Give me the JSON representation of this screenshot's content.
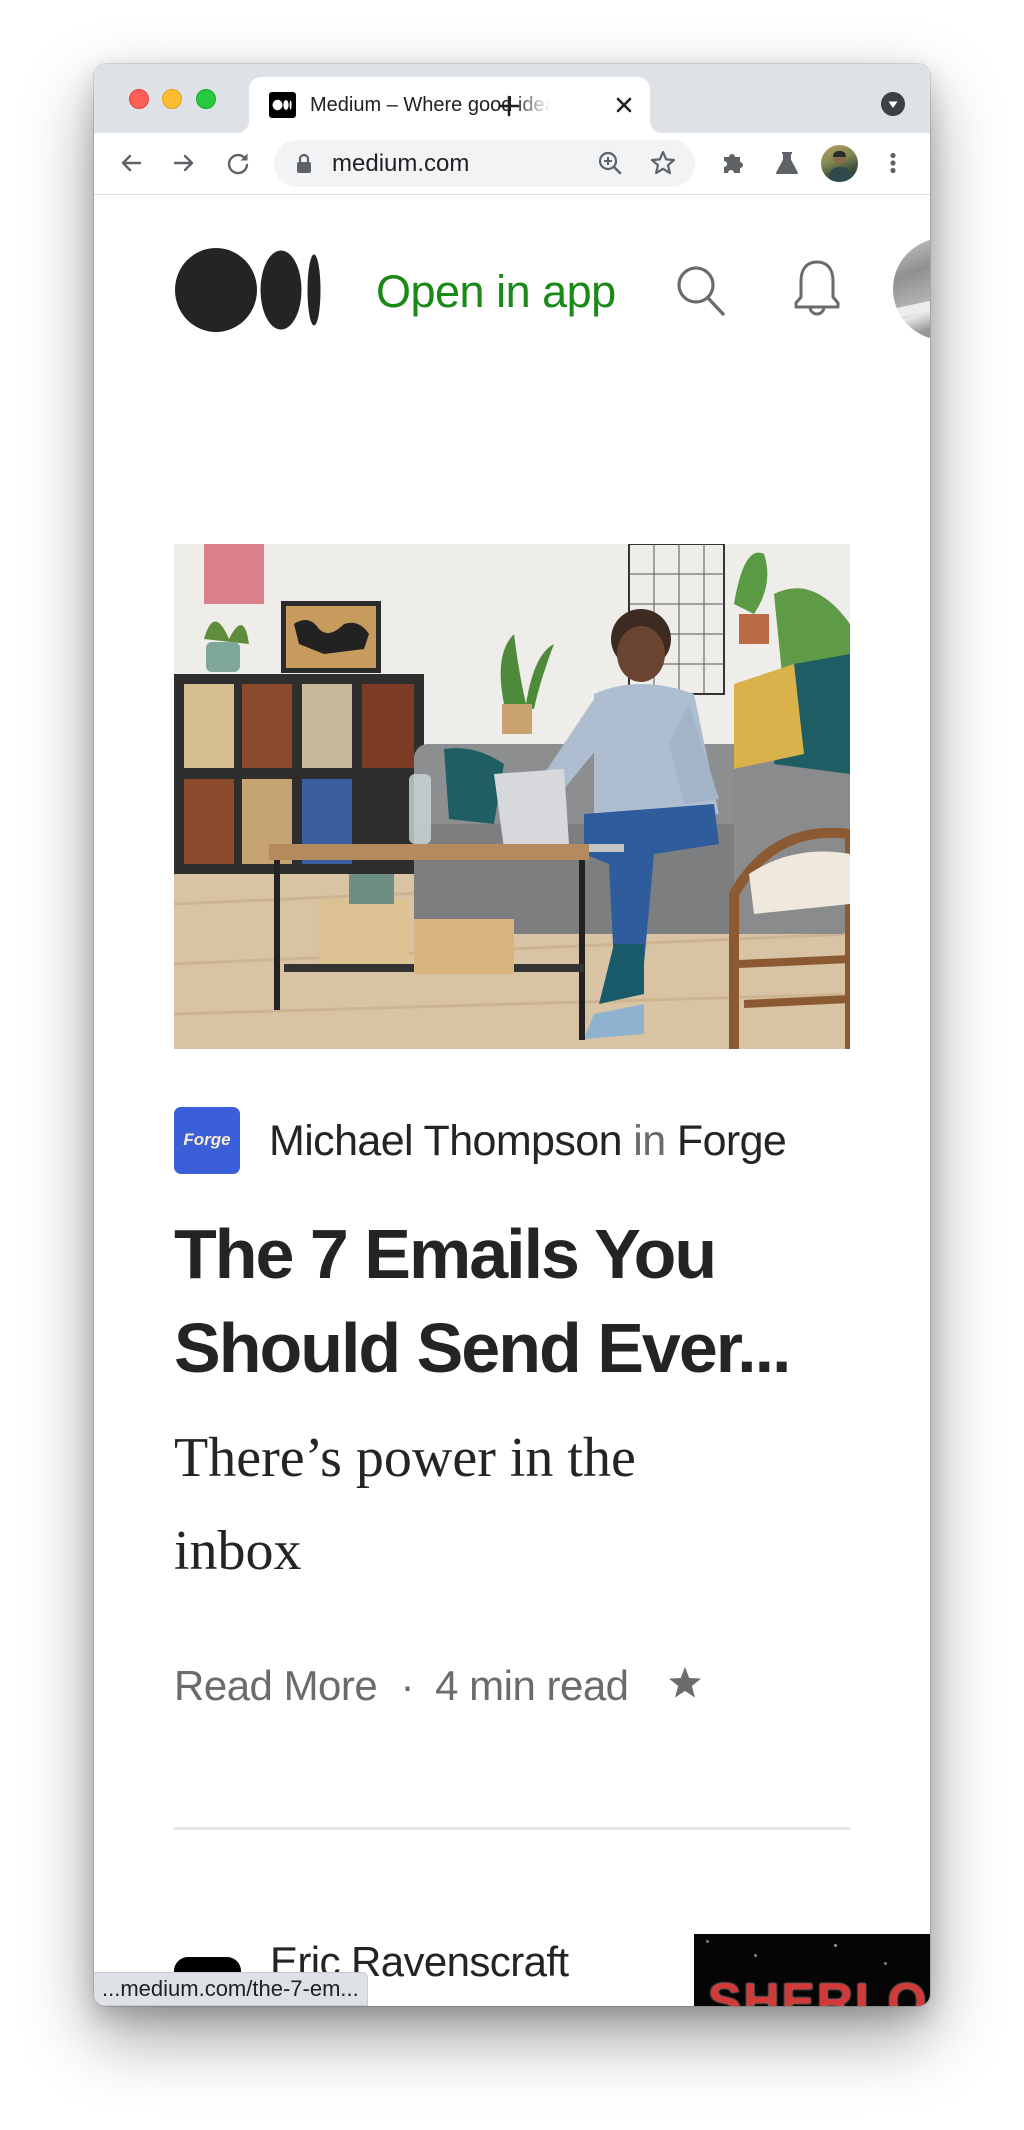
{
  "browser": {
    "tab": {
      "title": "Medium – Where good ideas find you.",
      "favicon": "medium-logo-icon"
    },
    "new_tab_icon": "plus-icon",
    "tab_menu_icon": "chevron-down-circle-icon",
    "nav": {
      "back_icon": "arrow-left-icon",
      "forward_icon": "arrow-right-icon",
      "reload_icon": "reload-icon"
    },
    "omnibox": {
      "url": "medium.com",
      "lock_icon": "lock-icon",
      "zoom_icon": "zoom-in-icon",
      "bookmark_icon": "star-outline-icon"
    },
    "toolbar_icons": [
      "puzzle-extensions-icon",
      "flask-labs-icon",
      "profile-avatar",
      "kebab-menu-icon"
    ],
    "status_bar": "...medium.com/the-7-em..."
  },
  "header": {
    "logo": "medium-logo",
    "open_in_app": "Open in app",
    "search_icon": "search-icon",
    "notifications_icon": "bell-icon",
    "avatar": "user-avatar"
  },
  "colors": {
    "accent_green": "#1a8917",
    "text_primary": "#242424",
    "text_secondary": "#6b6b6b",
    "forge_blue": "#3b5fd9"
  },
  "feed": [
    {
      "publication_icon_text": "Forge",
      "author": "Michael Thompson",
      "connector": "in",
      "publication": "Forge",
      "title_line1": "The 7 Emails You",
      "title_line2": "Should Send Ever...",
      "subtitle_line1": "There’s power in the",
      "subtitle_line2": "inbox",
      "read_more": "Read More",
      "separator": "·",
      "read_time": "4 min read",
      "member_icon": "star-icon"
    },
    {
      "author": "Eric Ravenscraft",
      "thumbnail_text": "SHERLO"
    }
  ]
}
